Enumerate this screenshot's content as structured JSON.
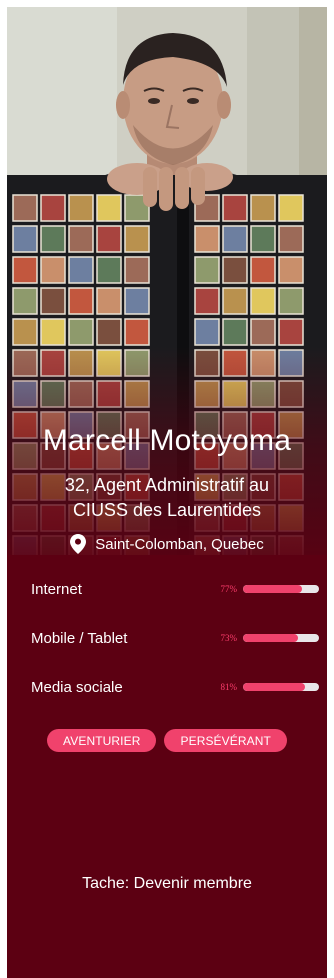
{
  "profile": {
    "name": "Marcell Motoyoma",
    "role_line1": "32, Agent Administratif au",
    "role_line2": "CIUSS des Laurentides",
    "location": "Saint-Colomban, Quebec",
    "location_icon": "location-pin-icon",
    "photo_description_icon": "profile-photo"
  },
  "skills": [
    {
      "label": "Internet",
      "percent_label": "77%",
      "value": 0.77
    },
    {
      "label": "Mobile / Tablet",
      "percent_label": "73%",
      "value": 0.73
    },
    {
      "label": "Media sociale",
      "percent_label": "81%",
      "value": 0.81
    }
  ],
  "traits": [
    {
      "label": "AVENTURIER"
    },
    {
      "label": "PERSÉVÉRANT"
    }
  ],
  "task": "Tache: Devenir membre",
  "colors": {
    "card_background": "#5c0012",
    "accent": "#f0426c",
    "bar_track": "#e9e6e9",
    "percent_text": "#ff3d6e",
    "text": "#ffffff"
  }
}
